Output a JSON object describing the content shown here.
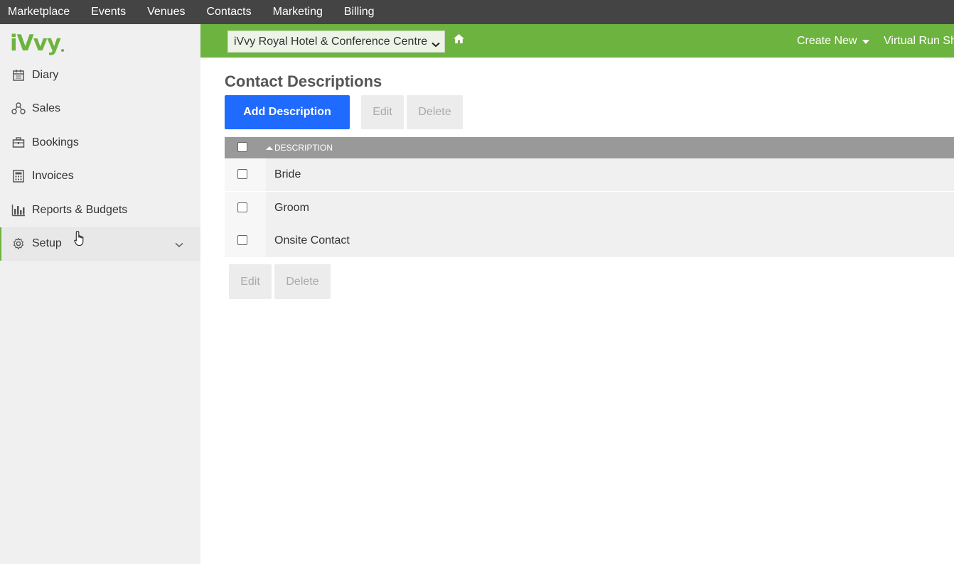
{
  "topnav": {
    "items": [
      "Marketplace",
      "Events",
      "Venues",
      "Contacts",
      "Marketing",
      "Billing"
    ]
  },
  "logo": {
    "text": "iVvy"
  },
  "sidebar": {
    "items": [
      {
        "label": "Diary",
        "icon": "calendar-icon"
      },
      {
        "label": "Sales",
        "icon": "sales-icon"
      },
      {
        "label": "Bookings",
        "icon": "briefcase-icon"
      },
      {
        "label": "Invoices",
        "icon": "calculator-icon"
      },
      {
        "label": "Reports & Budgets",
        "icon": "bar-chart-icon"
      },
      {
        "label": "Setup",
        "icon": "gear-icon"
      }
    ]
  },
  "header": {
    "venue": "iVvy Royal Hotel & Conference Centre",
    "create_new": "Create New",
    "virtual_run": "Virtual Run Sheet"
  },
  "page": {
    "title": "Contact Descriptions",
    "add_button": "Add Description",
    "edit_button": "Edit",
    "delete_button": "Delete"
  },
  "grid": {
    "column": "DESCRIPTION",
    "rows": [
      "Bride",
      "Groom",
      "Onsite Contact"
    ]
  },
  "colors": {
    "topnav": "#444444",
    "accent_green": "#6db33f",
    "primary_blue": "#1f6bff"
  }
}
